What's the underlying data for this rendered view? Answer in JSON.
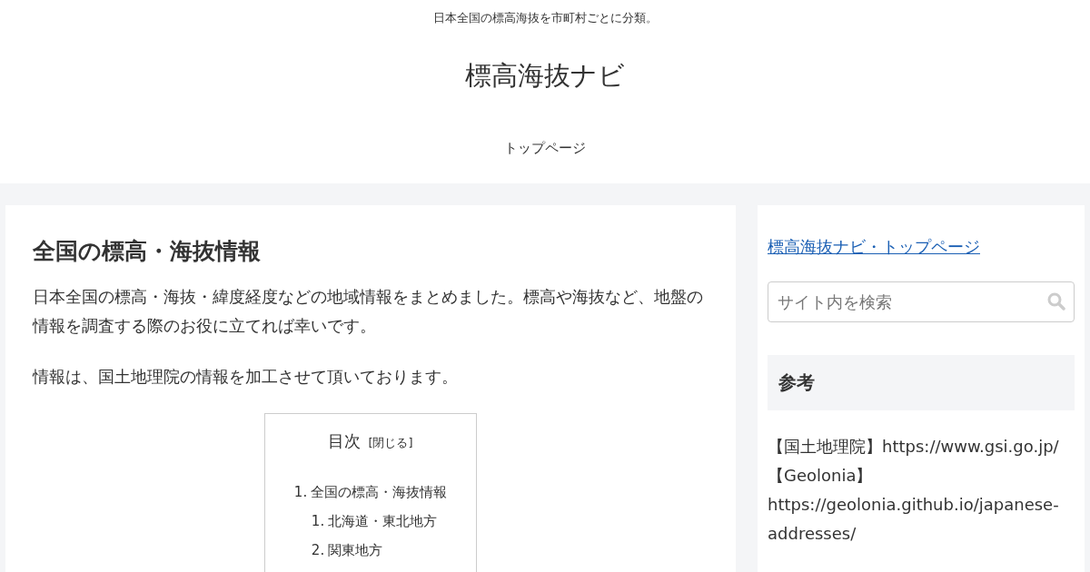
{
  "header": {
    "tagline": "日本全国の標高海抜を市町村ごとに分類。",
    "site_title": "標高海抜ナビ",
    "nav": [
      {
        "label": "トップページ"
      }
    ]
  },
  "article": {
    "title": "全国の標高・海抜情報",
    "paragraphs": [
      "日本全国の標高・海抜・緯度経度などの地域情報をまとめました。標高や海抜など、地盤の情報を調査する際のお役に立てれば幸いです。",
      "情報は、国土地理院の情報を加工させて頂いております。"
    ],
    "toc": {
      "title": "目次",
      "toggle": "[閉じる]",
      "items": [
        {
          "number": "1.",
          "label": "全国の標高・海抜情報",
          "children": [
            {
              "number": "1.",
              "label": "北海道・東北地方"
            },
            {
              "number": "2.",
              "label": "関東地方"
            }
          ]
        }
      ]
    }
  },
  "sidebar": {
    "link": "標高海抜ナビ・トップページ",
    "search": {
      "placeholder": "サイト内を検索"
    },
    "section_title": "参考",
    "references": [
      "【国土地理院】https://www.gsi.go.jp/",
      "【Geolonia】",
      "https://geolonia.github.io/japanese-addresses/"
    ]
  }
}
